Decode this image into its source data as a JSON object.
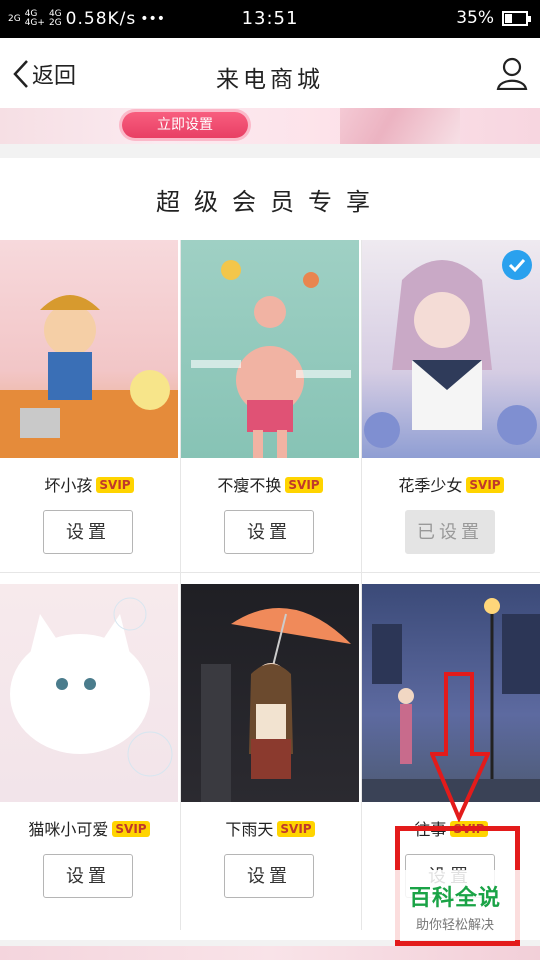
{
  "status_bar": {
    "signal_top": "2G",
    "signal_mid_a": "4G",
    "signal_mid_b": "4G",
    "signal_bottom_a": "4G+",
    "signal_bottom_b": "2G",
    "network_speed": "0.58K/s",
    "dots": "•••",
    "time": "13:51",
    "battery": "35%",
    "battery_level": 0.35
  },
  "nav": {
    "back_label": "返回",
    "title": "来电商城"
  },
  "banner": {
    "button_label": "立即设置"
  },
  "section_title": "超级会员专享",
  "badge_text": "SVIP",
  "cards": [
    {
      "name": "坏小孩",
      "button": "设置",
      "selected": false
    },
    {
      "name": "不瘦不换",
      "button": "设置",
      "selected": false
    },
    {
      "name": "花季少女",
      "button": "已设置",
      "selected": true
    },
    {
      "name": "猫咪小可爱",
      "button": "设置",
      "selected": false
    },
    {
      "name": "下雨天",
      "button": "设置",
      "selected": false
    },
    {
      "name": "往事",
      "button": "设置",
      "selected": false
    }
  ],
  "watermark": {
    "title": "百科全说",
    "subtitle": "助你轻松解决"
  },
  "colors": {
    "accent_pink": "#e83f64",
    "svip_yellow": "#ffd400",
    "check_blue": "#2aa1ee",
    "annotation_red": "#e31b1b",
    "watermark_green": "#1aa346"
  }
}
